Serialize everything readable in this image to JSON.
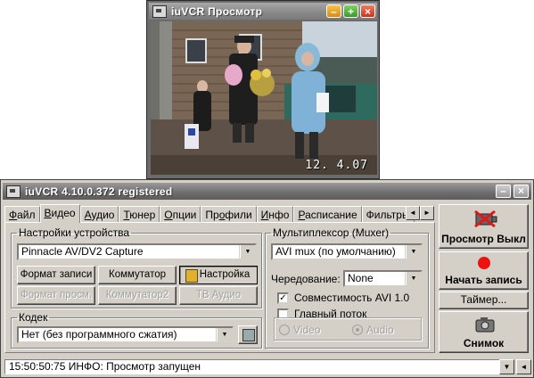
{
  "preview": {
    "title": "iuVCR Просмотр",
    "controls": {
      "minimize": "–",
      "maximize": "+",
      "close": "×"
    },
    "timestamp": "12. 4.07"
  },
  "main": {
    "title": "iuVCR 4.10.0.372 registered",
    "tabs": [
      {
        "pre": "",
        "ul": "Ф",
        "post": "айл"
      },
      {
        "pre": "",
        "ul": "В",
        "post": "идео"
      },
      {
        "pre": "",
        "ul": "А",
        "post": "удио"
      },
      {
        "pre": "",
        "ul": "Т",
        "post": "юнер"
      },
      {
        "pre": "",
        "ul": "О",
        "post": "пции"
      },
      {
        "pre": "Пр",
        "ul": "о",
        "post": "фили"
      },
      {
        "pre": "",
        "ul": "И",
        "post": "нфо"
      },
      {
        "pre": "",
        "ul": "Р",
        "post": "асписание"
      },
      {
        "pre": "Фильтры",
        "ul": "",
        "post": ""
      }
    ],
    "tab_scroll": {
      "left": "◄",
      "right": "►"
    },
    "device": {
      "legend": "Настройки устройства",
      "selected": "Pinnacle AV/DV2 Capture",
      "buttons": {
        "format_record": "Формат записи",
        "switcher": "Коммутатор",
        "settings": "Настройка",
        "format_preview": "Формат просм.",
        "switcher2": "Коммутатор2",
        "tv_audio": "ТВ Аудио"
      }
    },
    "codec": {
      "legend": "Кодек",
      "selected": "Нет (без программного сжатия)"
    },
    "muxer": {
      "legend": "Мультиплексор (Muxer)",
      "selected": "AVI mux (по умолчанию)",
      "interleave_label": "Чередование:",
      "interleave_value": "None",
      "avi_compat": "Совместимость AVI 1.0",
      "avi_compat_checked": true,
      "main_stream": "Главный поток",
      "main_stream_checked": false,
      "radio_video": "Video",
      "radio_audio": "Audio",
      "radio_selected": "audio"
    },
    "actions": {
      "preview_off": "Просмотр Выкл",
      "start_record": "Начать запись",
      "timer": "Таймер...",
      "snapshot": "Снимок"
    },
    "status": "15:50:50:75 ИНФО: Просмотр запущен",
    "status_scroll": {
      "down": "▼",
      "left": "◄"
    },
    "colors": {
      "record_dot": "#ee1111",
      "window_face": "#d4d0c8"
    }
  }
}
